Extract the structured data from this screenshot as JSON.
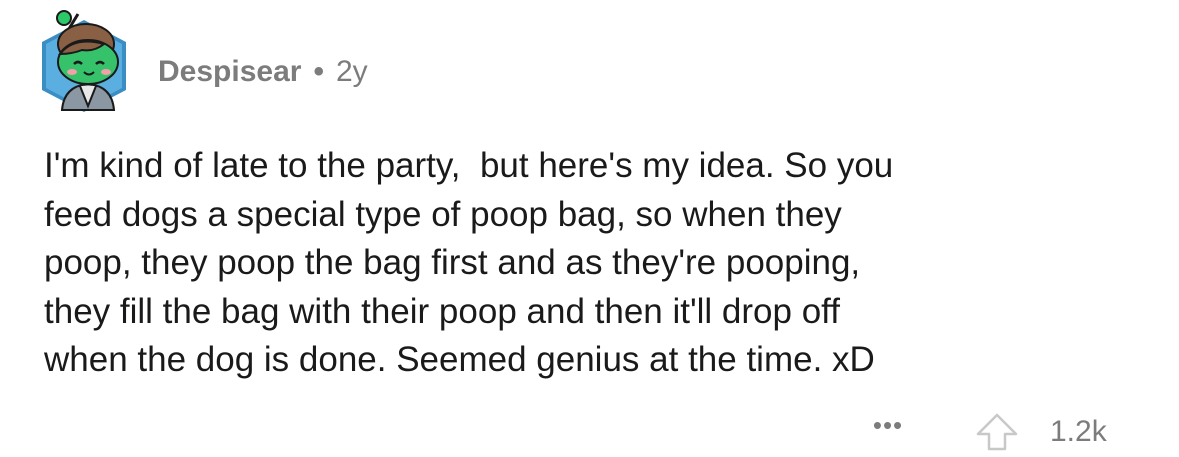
{
  "comment": {
    "username": "Despisear",
    "separator": "•",
    "age": "2y",
    "body_lines": [
      "I'm kind of late to the party,  but here's my idea. So you",
      "feed dogs a special type of poop bag, so when they",
      "poop, they poop the bag first and as they're pooping,",
      "they fill the bag with their poop and then it'll drop off",
      "when the dog is done. Seemed genius at the time. xD"
    ],
    "more_label": "•••",
    "score": "1.2k",
    "icons": {
      "avatar": "reddit-snoo-avatar",
      "more": "more-options-icon",
      "upvote": "upvote-arrow-icon"
    }
  }
}
